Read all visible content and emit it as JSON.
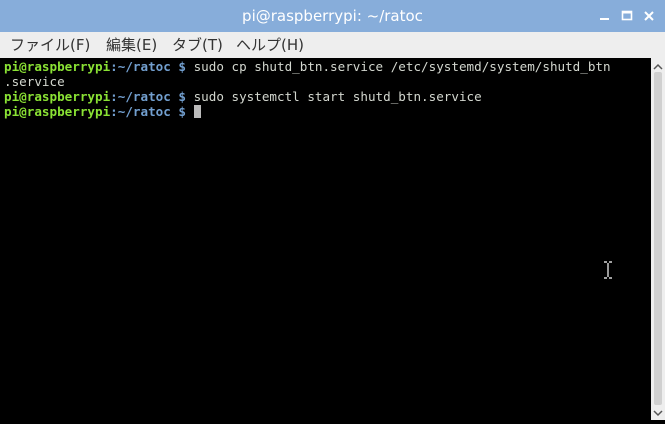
{
  "window": {
    "title": "pi@raspberrypi: ~/ratoc",
    "controls": [
      "minimize-icon",
      "maximize-icon",
      "close-icon"
    ]
  },
  "menubar": {
    "items": [
      {
        "label": "ファイル(F)"
      },
      {
        "label": "編集(E)"
      },
      {
        "label": "タブ(T)"
      },
      {
        "label": "ヘルプ(H)"
      }
    ]
  },
  "terminal": {
    "lines": [
      {
        "user": "pi@raspberrypi",
        "path": ":~/ratoc",
        "dollar": " $",
        "command": " sudo cp shutd_btn.service /etc/systemd/system/shutd_btn"
      },
      {
        "continuation": ".service"
      },
      {
        "user": "pi@raspberrypi",
        "path": ":~/ratoc",
        "dollar": " $",
        "command": " sudo systemctl start shutd_btn.service"
      },
      {
        "user": "pi@raspberrypi",
        "path": ":~/ratoc",
        "dollar": " $",
        "command": " "
      }
    ]
  },
  "colors": {
    "titlebar": "#87ADDA",
    "prompt_user": "#8ae234",
    "prompt_path": "#729fcf",
    "background": "#000000"
  }
}
